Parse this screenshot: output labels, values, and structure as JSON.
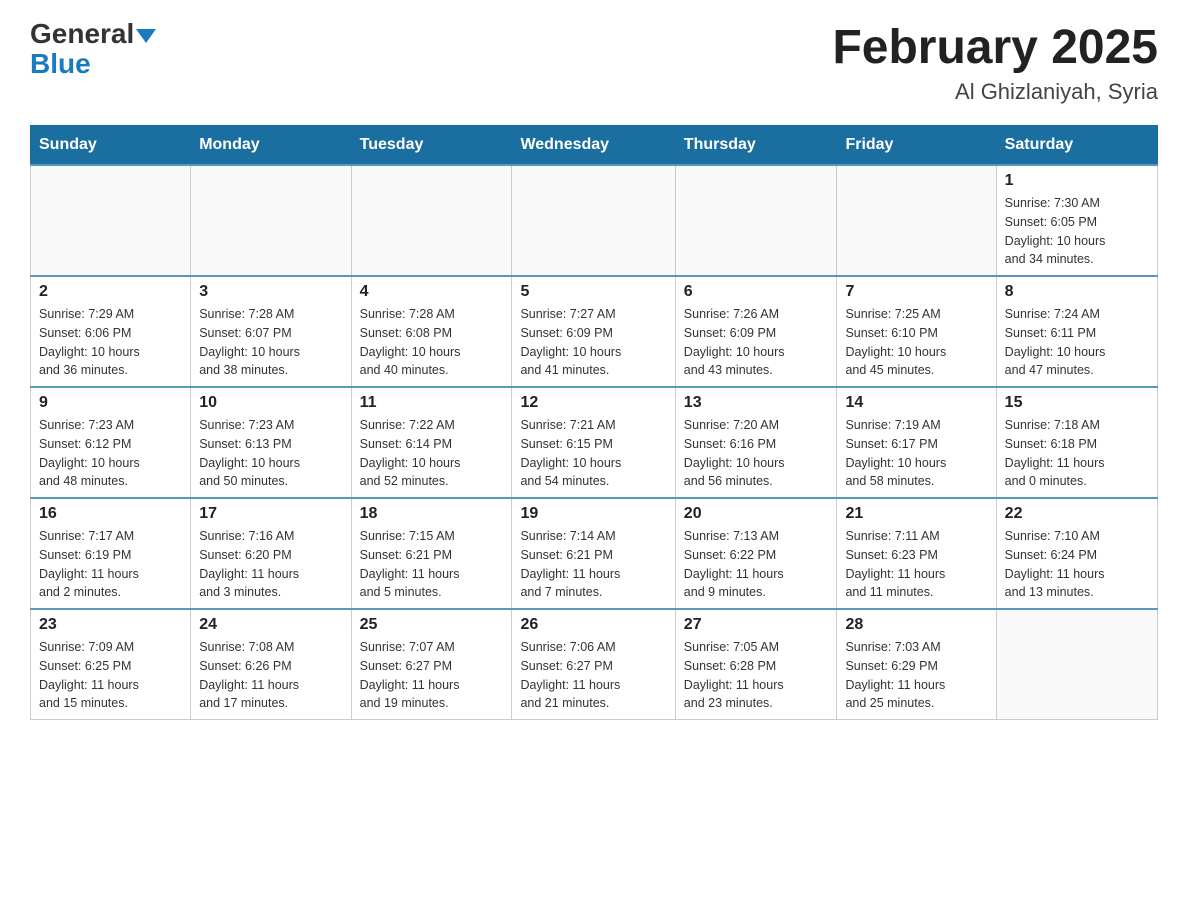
{
  "header": {
    "logo_general": "General",
    "logo_blue": "Blue",
    "month_title": "February 2025",
    "location": "Al Ghizlaniyah, Syria"
  },
  "days_of_week": [
    "Sunday",
    "Monday",
    "Tuesday",
    "Wednesday",
    "Thursday",
    "Friday",
    "Saturday"
  ],
  "weeks": [
    [
      {
        "day": "",
        "info": ""
      },
      {
        "day": "",
        "info": ""
      },
      {
        "day": "",
        "info": ""
      },
      {
        "day": "",
        "info": ""
      },
      {
        "day": "",
        "info": ""
      },
      {
        "day": "",
        "info": ""
      },
      {
        "day": "1",
        "info": "Sunrise: 7:30 AM\nSunset: 6:05 PM\nDaylight: 10 hours\nand 34 minutes."
      }
    ],
    [
      {
        "day": "2",
        "info": "Sunrise: 7:29 AM\nSunset: 6:06 PM\nDaylight: 10 hours\nand 36 minutes."
      },
      {
        "day": "3",
        "info": "Sunrise: 7:28 AM\nSunset: 6:07 PM\nDaylight: 10 hours\nand 38 minutes."
      },
      {
        "day": "4",
        "info": "Sunrise: 7:28 AM\nSunset: 6:08 PM\nDaylight: 10 hours\nand 40 minutes."
      },
      {
        "day": "5",
        "info": "Sunrise: 7:27 AM\nSunset: 6:09 PM\nDaylight: 10 hours\nand 41 minutes."
      },
      {
        "day": "6",
        "info": "Sunrise: 7:26 AM\nSunset: 6:09 PM\nDaylight: 10 hours\nand 43 minutes."
      },
      {
        "day": "7",
        "info": "Sunrise: 7:25 AM\nSunset: 6:10 PM\nDaylight: 10 hours\nand 45 minutes."
      },
      {
        "day": "8",
        "info": "Sunrise: 7:24 AM\nSunset: 6:11 PM\nDaylight: 10 hours\nand 47 minutes."
      }
    ],
    [
      {
        "day": "9",
        "info": "Sunrise: 7:23 AM\nSunset: 6:12 PM\nDaylight: 10 hours\nand 48 minutes."
      },
      {
        "day": "10",
        "info": "Sunrise: 7:23 AM\nSunset: 6:13 PM\nDaylight: 10 hours\nand 50 minutes."
      },
      {
        "day": "11",
        "info": "Sunrise: 7:22 AM\nSunset: 6:14 PM\nDaylight: 10 hours\nand 52 minutes."
      },
      {
        "day": "12",
        "info": "Sunrise: 7:21 AM\nSunset: 6:15 PM\nDaylight: 10 hours\nand 54 minutes."
      },
      {
        "day": "13",
        "info": "Sunrise: 7:20 AM\nSunset: 6:16 PM\nDaylight: 10 hours\nand 56 minutes."
      },
      {
        "day": "14",
        "info": "Sunrise: 7:19 AM\nSunset: 6:17 PM\nDaylight: 10 hours\nand 58 minutes."
      },
      {
        "day": "15",
        "info": "Sunrise: 7:18 AM\nSunset: 6:18 PM\nDaylight: 11 hours\nand 0 minutes."
      }
    ],
    [
      {
        "day": "16",
        "info": "Sunrise: 7:17 AM\nSunset: 6:19 PM\nDaylight: 11 hours\nand 2 minutes."
      },
      {
        "day": "17",
        "info": "Sunrise: 7:16 AM\nSunset: 6:20 PM\nDaylight: 11 hours\nand 3 minutes."
      },
      {
        "day": "18",
        "info": "Sunrise: 7:15 AM\nSunset: 6:21 PM\nDaylight: 11 hours\nand 5 minutes."
      },
      {
        "day": "19",
        "info": "Sunrise: 7:14 AM\nSunset: 6:21 PM\nDaylight: 11 hours\nand 7 minutes."
      },
      {
        "day": "20",
        "info": "Sunrise: 7:13 AM\nSunset: 6:22 PM\nDaylight: 11 hours\nand 9 minutes."
      },
      {
        "day": "21",
        "info": "Sunrise: 7:11 AM\nSunset: 6:23 PM\nDaylight: 11 hours\nand 11 minutes."
      },
      {
        "day": "22",
        "info": "Sunrise: 7:10 AM\nSunset: 6:24 PM\nDaylight: 11 hours\nand 13 minutes."
      }
    ],
    [
      {
        "day": "23",
        "info": "Sunrise: 7:09 AM\nSunset: 6:25 PM\nDaylight: 11 hours\nand 15 minutes."
      },
      {
        "day": "24",
        "info": "Sunrise: 7:08 AM\nSunset: 6:26 PM\nDaylight: 11 hours\nand 17 minutes."
      },
      {
        "day": "25",
        "info": "Sunrise: 7:07 AM\nSunset: 6:27 PM\nDaylight: 11 hours\nand 19 minutes."
      },
      {
        "day": "26",
        "info": "Sunrise: 7:06 AM\nSunset: 6:27 PM\nDaylight: 11 hours\nand 21 minutes."
      },
      {
        "day": "27",
        "info": "Sunrise: 7:05 AM\nSunset: 6:28 PM\nDaylight: 11 hours\nand 23 minutes."
      },
      {
        "day": "28",
        "info": "Sunrise: 7:03 AM\nSunset: 6:29 PM\nDaylight: 11 hours\nand 25 minutes."
      },
      {
        "day": "",
        "info": ""
      }
    ]
  ]
}
